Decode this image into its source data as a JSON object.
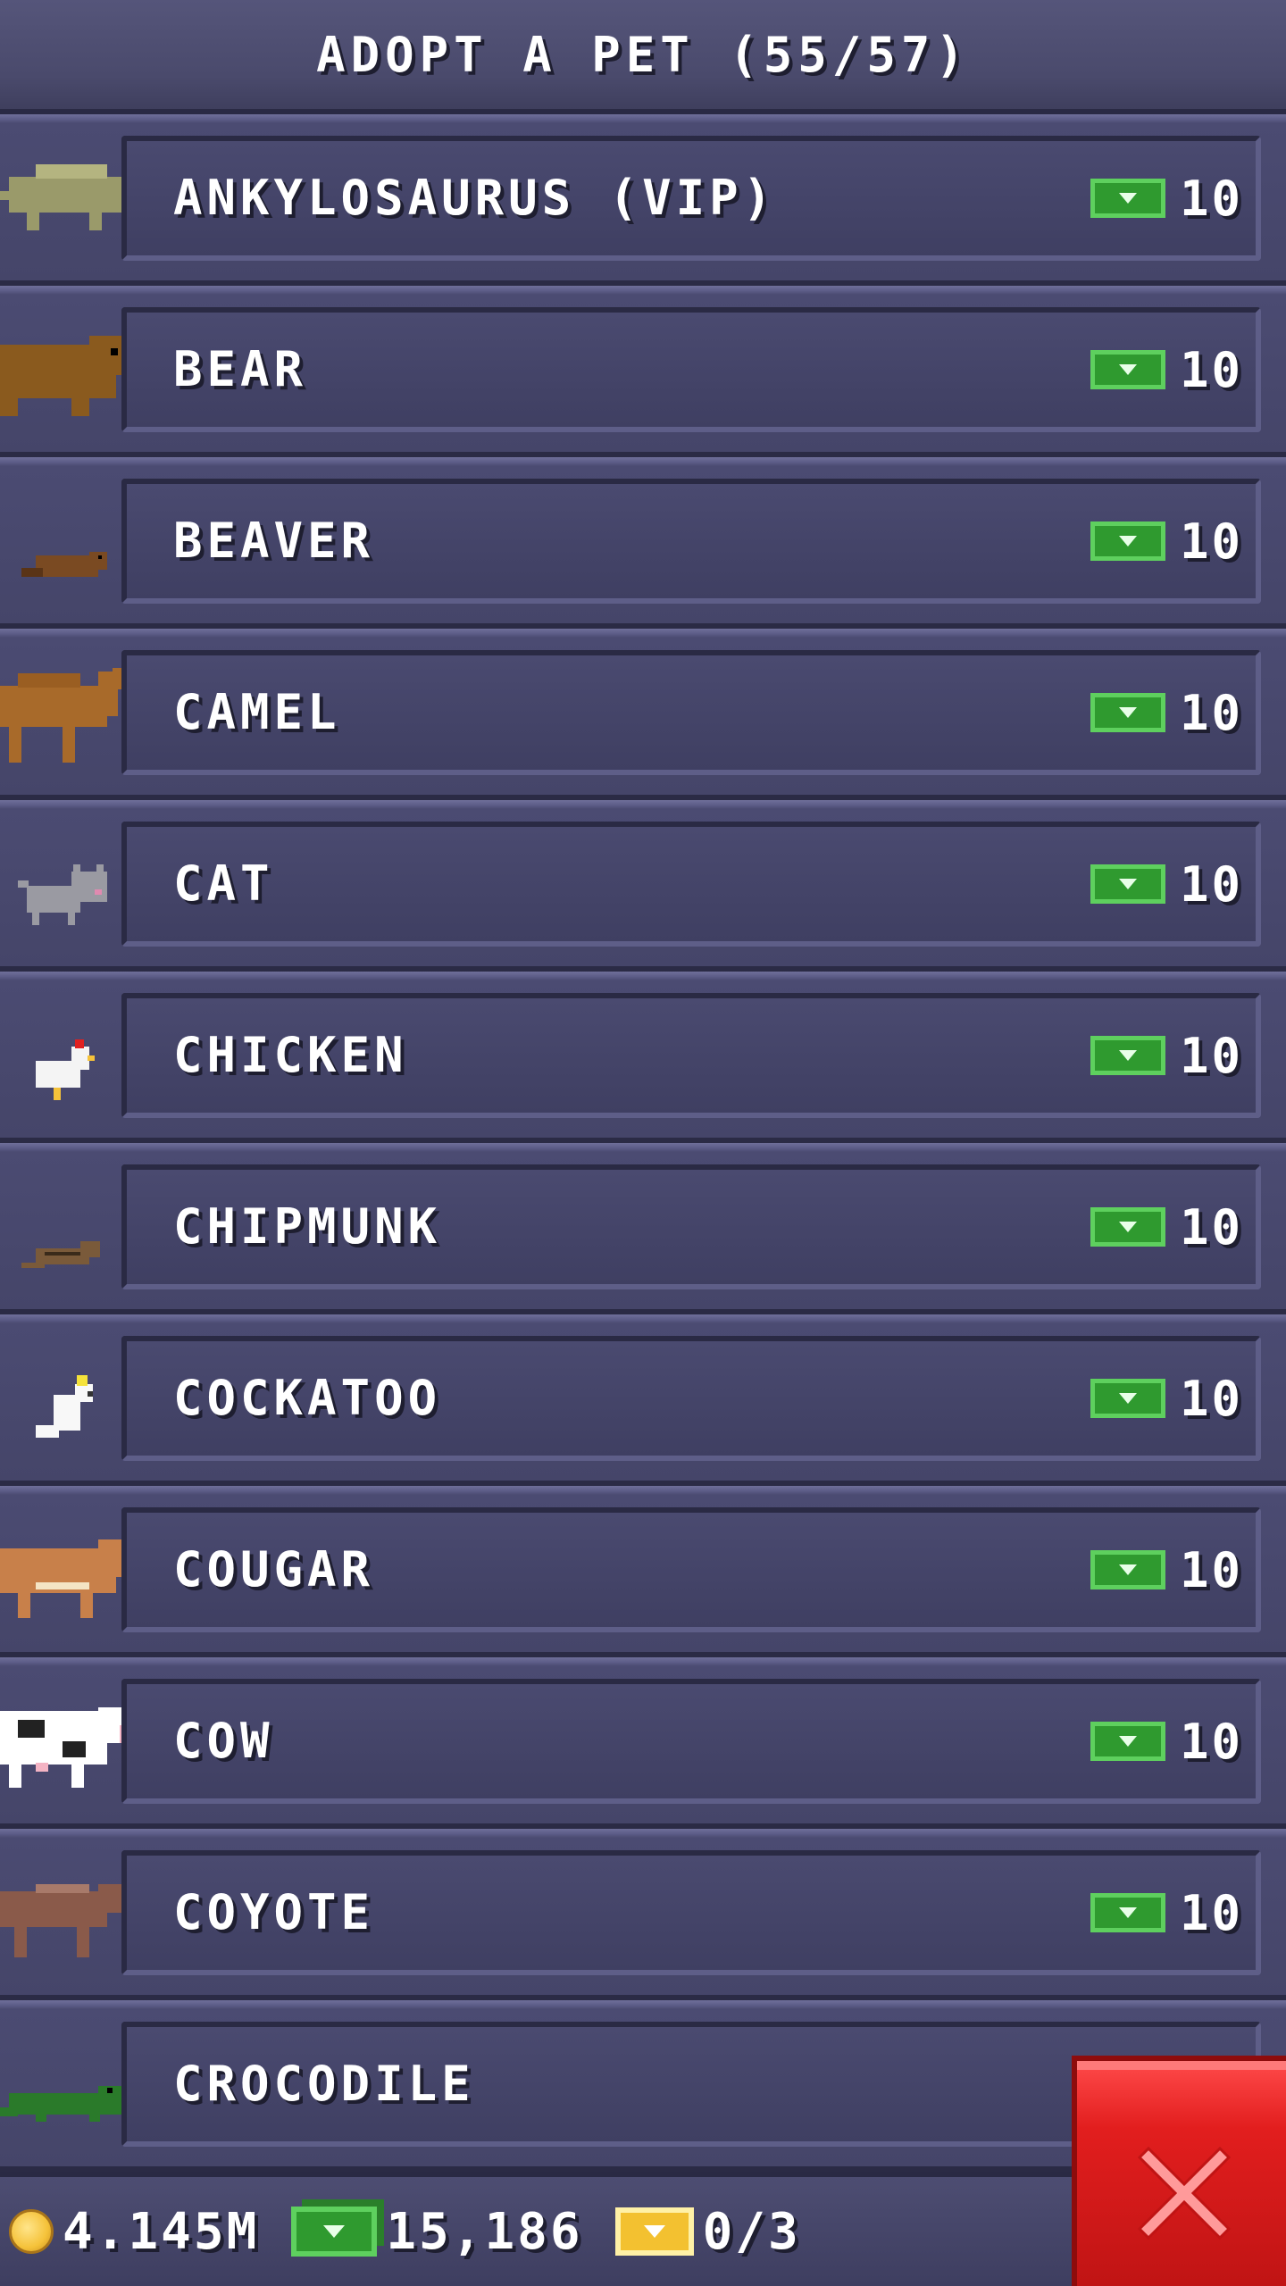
{
  "header": {
    "title": "ADOPT A PET (55/57)"
  },
  "pets": [
    {
      "name": "ANKYLOSAURUS (VIP)",
      "price": "10",
      "icon": "ankylosaurus-icon",
      "color": "#9a9a6a"
    },
    {
      "name": "BEAR",
      "price": "10",
      "icon": "bear-icon",
      "color": "#8a5a1e"
    },
    {
      "name": "BEAVER",
      "price": "10",
      "icon": "beaver-icon",
      "color": "#7a4a22"
    },
    {
      "name": "CAMEL",
      "price": "10",
      "icon": "camel-icon",
      "color": "#a86a2a"
    },
    {
      "name": "CAT",
      "price": "10",
      "icon": "cat-icon",
      "color": "#9a9aa2"
    },
    {
      "name": "CHICKEN",
      "price": "10",
      "icon": "chicken-icon",
      "color": "#f4f4f4"
    },
    {
      "name": "CHIPMUNK",
      "price": "10",
      "icon": "chipmunk-icon",
      "color": "#7a5a3a"
    },
    {
      "name": "COCKATOO",
      "price": "10",
      "icon": "cockatoo-icon",
      "color": "#f8f8f8"
    },
    {
      "name": "COUGAR",
      "price": "10",
      "icon": "cougar-icon",
      "color": "#c8804a"
    },
    {
      "name": "COW",
      "price": "10",
      "icon": "cow-icon",
      "color": "#ffffff"
    },
    {
      "name": "COYOTE",
      "price": "10",
      "icon": "coyote-icon",
      "color": "#8a5a4a"
    },
    {
      "name": "CROCODILE",
      "price": "",
      "icon": "crocodile-icon",
      "color": "#2a7a2a"
    }
  ],
  "footer": {
    "coins": "4.145M",
    "cash": "15,186",
    "tickets": "0/3"
  },
  "close_button": {
    "icon": "close-icon"
  },
  "colors": {
    "accent_green": "#2f9a2f",
    "close_red": "#e21e1e",
    "panel": "#454569"
  }
}
